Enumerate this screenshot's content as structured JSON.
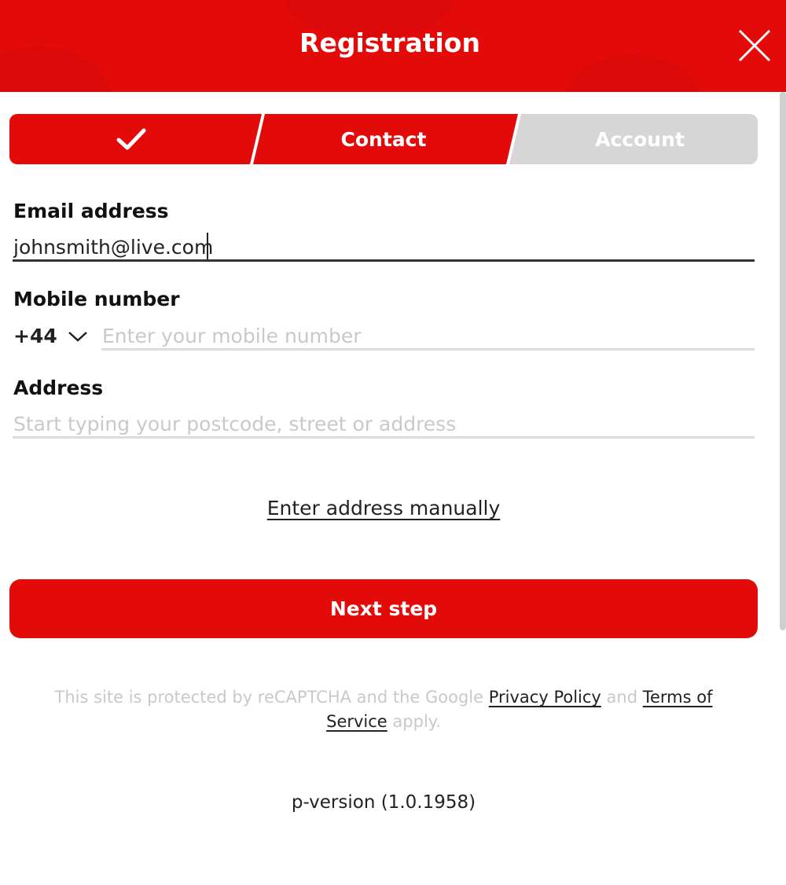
{
  "header": {
    "title": "Registration",
    "close_icon": "close-icon"
  },
  "stepper": {
    "steps": [
      {
        "label": "",
        "state": "completed",
        "icon": "check-icon"
      },
      {
        "label": "Contact",
        "state": "active"
      },
      {
        "label": "Account",
        "state": "pending"
      }
    ]
  },
  "form": {
    "email": {
      "label": "Email address",
      "value": "johnsmith@live.com"
    },
    "mobile": {
      "label": "Mobile number",
      "country_code": "+44",
      "dropdown_icon": "chevron-down-icon",
      "value": "",
      "placeholder": "Enter your mobile number"
    },
    "address": {
      "label": "Address",
      "value": "",
      "placeholder": "Start typing your postcode, street or address"
    },
    "manual_link": "Enter address manually",
    "next_button": "Next step"
  },
  "recaptcha": {
    "prefix": "This site is protected by reCAPTCHA and the Google ",
    "privacy_link": "Privacy Policy",
    "and_text": " and ",
    "terms_link": "Terms of Service",
    "suffix": " apply."
  },
  "version": "p-version (1.0.1958)",
  "colors": {
    "brand_red": "#e30a0a",
    "inactive_step": "#d6d6d6",
    "placeholder": "#c9c9c9",
    "text": "#111111"
  }
}
